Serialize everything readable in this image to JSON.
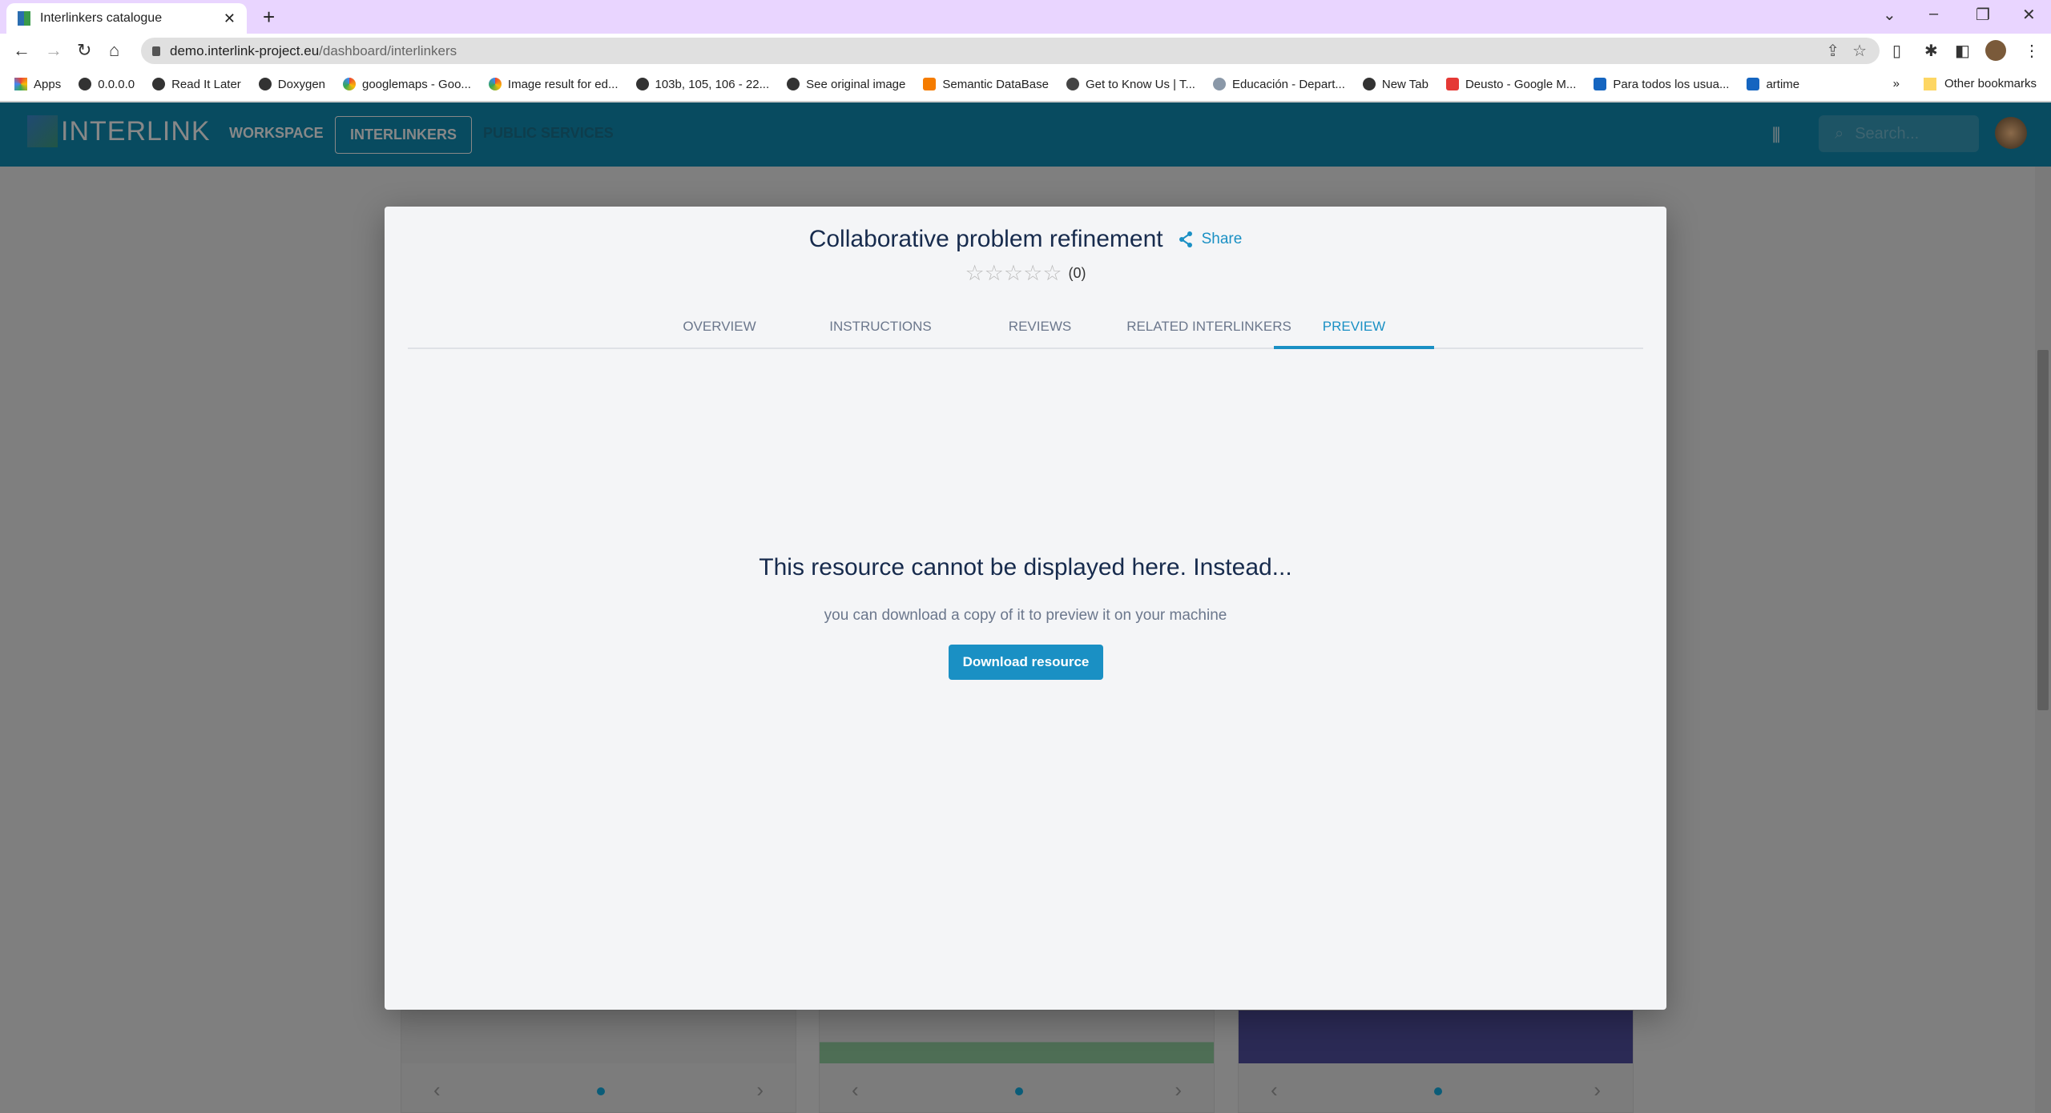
{
  "browser": {
    "tab_title": "Interlinkers catalogue",
    "url_host": "demo.interlink-project.eu",
    "url_path": "/dashboard/interlinkers",
    "bookmarks": [
      "Apps",
      "0.0.0.0",
      "Read It Later",
      "Doxygen",
      "googlemaps - Goo...",
      "Image result for ed...",
      "103b, 105, 106 - 22...",
      "See original image",
      "Semantic DataBase",
      "Get to Know Us | T...",
      "Educación - Depart...",
      "New Tab",
      "Deusto - Google M...",
      "Para todos los usua...",
      "artime"
    ],
    "other_bookmarks": "Other bookmarks"
  },
  "app": {
    "logo": "INTERLINK",
    "nav": [
      "WORKSPACE",
      "INTERLINKERS",
      "PUBLIC SERVICES"
    ],
    "search_placeholder": "Search..."
  },
  "modal": {
    "title": "Collaborative problem refinement",
    "share": "Share",
    "rating": 0,
    "rating_count": "(0)",
    "tabs": [
      "OVERVIEW",
      "INSTRUCTIONS",
      "REVIEWS",
      "RELATED INTERLINKERS",
      "PREVIEW"
    ],
    "active_tab": "PREVIEW",
    "message": "This resource cannot be displayed here. Instead...",
    "sub": "you can download a copy of it to preview it on your machine",
    "download": "Download resource"
  },
  "colors": {
    "accent": "#1a90c4",
    "appbar": "#084b60",
    "title": "#172b4d"
  }
}
